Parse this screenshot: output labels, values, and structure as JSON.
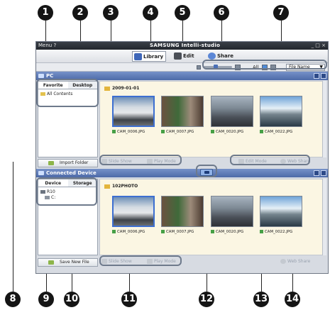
{
  "window": {
    "menu_label": "Menu ?",
    "brand": "SAMSUNG Intelli-studio",
    "controls": "_ □ ×"
  },
  "toolbar": {
    "library_label": "Library",
    "edit_label": "Edit",
    "share_label": "Share"
  },
  "viewbar": {
    "all_label": "All",
    "sort_value": "File Name"
  },
  "pc_panel": {
    "title": "PC",
    "tabs": [
      "Favorite",
      "Desktop"
    ],
    "tree": [
      "All Contents"
    ],
    "import_label": "Import Folder",
    "folder": "2009-01-01",
    "files": [
      "CAM_0006.JPG",
      "CAM_0007.JPG",
      "CAM_0020.JPG",
      "CAM_0022.JPG"
    ],
    "slide_show": "Slide Show",
    "play_mode": "Play Mode",
    "edit_mode": "Edit Mode",
    "web_share": "Web Share"
  },
  "device_panel": {
    "title": "Connected Device",
    "tabs": [
      "Device",
      "Storage"
    ],
    "tree": [
      "R10",
      "C:"
    ],
    "save_label": "Save New File",
    "folder": "102PHOTO",
    "files": [
      "CAM_0006.JPG",
      "CAM_0007.JPG",
      "CAM_0020.JPG",
      "CAM_0022.JPG"
    ],
    "slide_show": "Slide Show",
    "play_mode": "Play Mode",
    "web_share": "Web Share"
  },
  "callouts": [
    "1",
    "2",
    "3",
    "4",
    "5",
    "6",
    "7",
    "8",
    "9",
    "10",
    "11",
    "12",
    "13",
    "14"
  ],
  "colors": {
    "panel_header": "#5a76b2",
    "content_bg": "#fbf6e3",
    "highlight": "#6e7a8c",
    "callout": "#151515"
  }
}
